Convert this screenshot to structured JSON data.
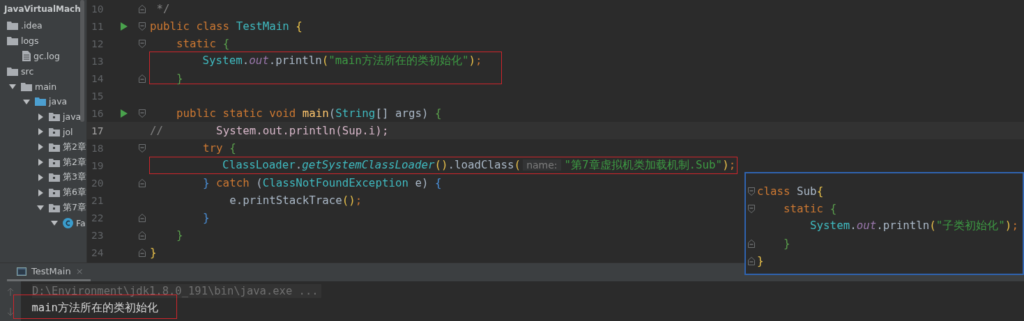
{
  "project_tree": {
    "title": "JavaVirtualMach",
    "items": [
      {
        "label": ".idea",
        "kind": "folder"
      },
      {
        "label": "logs",
        "kind": "folder",
        "children": [
          {
            "label": "gc.log",
            "kind": "file"
          }
        ]
      },
      {
        "label": "src",
        "kind": "folder",
        "children": [
          {
            "label": "main",
            "kind": "folder",
            "expanded": true,
            "children": [
              {
                "label": "java",
                "kind": "source-folder",
                "expanded": true,
                "children": [
                  {
                    "label": "java",
                    "kind": "package",
                    "expanded": false
                  },
                  {
                    "label": "jol",
                    "kind": "package",
                    "expanded": false
                  },
                  {
                    "label": "第2章",
                    "kind": "package",
                    "expanded": false
                  },
                  {
                    "label": "第2章",
                    "kind": "package",
                    "expanded": false
                  },
                  {
                    "label": "第3章",
                    "kind": "package",
                    "expanded": false
                  },
                  {
                    "label": "第6章",
                    "kind": "package",
                    "expanded": false
                  },
                  {
                    "label": "第7章",
                    "kind": "package",
                    "expanded": true,
                    "children": [
                      {
                        "label": "Fa",
                        "kind": "class",
                        "expanded": true
                      }
                    ]
                  }
                ]
              }
            ]
          }
        ]
      }
    ]
  },
  "editor": {
    "lines": [
      {
        "number": "10",
        "fold_close": true,
        "tokens": [
          {
            "kind": "comment",
            "text": " */"
          }
        ]
      },
      {
        "number": "11",
        "run": true,
        "fold_open": true,
        "tokens": [
          {
            "kind": "kw",
            "text": "public class "
          },
          {
            "kind": "type",
            "text": "TestMain "
          },
          {
            "kind": "brace-yellow",
            "text": "{"
          }
        ]
      },
      {
        "number": "12",
        "fold_open": true,
        "tokens": [
          {
            "kind": "kw",
            "text": "    static "
          },
          {
            "kind": "brace-green",
            "text": "{"
          }
        ]
      },
      {
        "number": "13",
        "kind": "framed-tall",
        "tokens": [
          {
            "kind": "type",
            "text": "        System"
          },
          {
            "kind": "plain",
            "text": "."
          },
          {
            "kind": "field",
            "text": "out"
          },
          {
            "kind": "plain",
            "text": ".println"
          },
          {
            "kind": "brace-yellow",
            "text": "("
          },
          {
            "kind": "str",
            "text": "\"main方法所在的类初始化\""
          },
          {
            "kind": "brace-yellow",
            "text": ")"
          },
          {
            "kind": "kw",
            "text": ";"
          }
        ]
      },
      {
        "number": "14",
        "fold_close": true,
        "tokens": [
          {
            "kind": "brace-green",
            "text": "    }"
          }
        ]
      },
      {
        "number": "15"
      },
      {
        "number": "16",
        "run": true,
        "fold_open": true,
        "tokens": [
          {
            "kind": "kw",
            "text": "    public static void "
          },
          {
            "kind": "decl",
            "text": "main"
          },
          {
            "kind": "plain",
            "text": "("
          },
          {
            "kind": "type",
            "text": "String"
          },
          {
            "kind": "plain",
            "text": "[] args) "
          },
          {
            "kind": "brace-green",
            "text": "{"
          }
        ]
      },
      {
        "number": "17",
        "current": true,
        "tokens": [
          {
            "kind": "comment",
            "text": "//"
          },
          {
            "kind": "commented",
            "text": "        System.out.println(Sup.i);"
          }
        ]
      },
      {
        "number": "18",
        "fold_open": true,
        "tokens": [
          {
            "kind": "kw",
            "text": "        try "
          },
          {
            "kind": "brace-green",
            "text": "{"
          }
        ]
      },
      {
        "number": "19",
        "kind": "framed",
        "tokens": [
          {
            "kind": "type",
            "text": "           ClassLoader"
          },
          {
            "kind": "plain",
            "text": "."
          },
          {
            "kind": "type-italic",
            "text": "getSystemClassLoader"
          },
          {
            "kind": "brace-yellow",
            "text": "()"
          },
          {
            "kind": "plain",
            "text": ".loadClass"
          },
          {
            "kind": "brace-yellow",
            "text": "("
          },
          {
            "kind": "hint",
            "text": "name:"
          },
          {
            "kind": "str",
            "text": "\"第7章虚拟机类加载机制.Sub\""
          },
          {
            "kind": "brace-yellow",
            "text": ")"
          },
          {
            "kind": "kw",
            "text": ";"
          }
        ]
      },
      {
        "number": "20",
        "fold_close": true,
        "tokens": [
          {
            "kind": "brace-blue",
            "text": "        } "
          },
          {
            "kind": "kw",
            "text": "catch "
          },
          {
            "kind": "plain",
            "text": "("
          },
          {
            "kind": "type",
            "text": "ClassNotFoundException "
          },
          {
            "kind": "plain",
            "text": "e) "
          },
          {
            "kind": "brace-blue",
            "text": "{"
          }
        ]
      },
      {
        "number": "21",
        "tokens": [
          {
            "kind": "plain",
            "text": "            e.printStackTrace"
          },
          {
            "kind": "brace-yellow",
            "text": "()"
          },
          {
            "kind": "kw",
            "text": ";"
          }
        ]
      },
      {
        "number": "22",
        "fold_close": true,
        "tokens": [
          {
            "kind": "brace-blue",
            "text": "        }"
          }
        ]
      },
      {
        "number": "23",
        "fold_close": true,
        "tokens": [
          {
            "kind": "brace-green",
            "text": "    }"
          }
        ]
      },
      {
        "number": "24",
        "fold_close": true,
        "tokens": [
          {
            "kind": "brace-yellow",
            "text": "}"
          }
        ]
      }
    ]
  },
  "popup": {
    "lines": [
      {
        "fold_open": true,
        "tokens": [
          {
            "kind": "kw",
            "text": "class "
          },
          {
            "kind": "plain",
            "text": "Sub"
          },
          {
            "kind": "brace-yellow",
            "text": "{"
          }
        ]
      },
      {
        "fold_open": true,
        "tokens": [
          {
            "kind": "kw",
            "text": "    static "
          },
          {
            "kind": "brace-green",
            "text": "{"
          }
        ]
      },
      {
        "tokens": [
          {
            "kind": "type",
            "text": "        System"
          },
          {
            "kind": "plain",
            "text": "."
          },
          {
            "kind": "field",
            "text": "out"
          },
          {
            "kind": "plain",
            "text": ".println"
          },
          {
            "kind": "brace-yellow",
            "text": "("
          },
          {
            "kind": "str",
            "text": "\"子类初始化\""
          },
          {
            "kind": "brace-yellow",
            "text": ")"
          },
          {
            "kind": "kw",
            "text": ";"
          }
        ]
      },
      {
        "fold_close": true,
        "tokens": [
          {
            "kind": "brace-green",
            "text": "    }"
          }
        ]
      },
      {
        "fold_close": true,
        "tokens": [
          {
            "kind": "brace-yellow",
            "text": "}"
          }
        ]
      }
    ]
  },
  "run_panel": {
    "tab": {
      "label": "TestMain",
      "close": "×"
    },
    "console": [
      {
        "kind": "command",
        "text": "D:\\Environment\\jdk1.8.0_191\\bin\\java.exe ..."
      },
      {
        "kind": "output-framed",
        "text": "main方法所在的类初始化"
      }
    ]
  }
}
